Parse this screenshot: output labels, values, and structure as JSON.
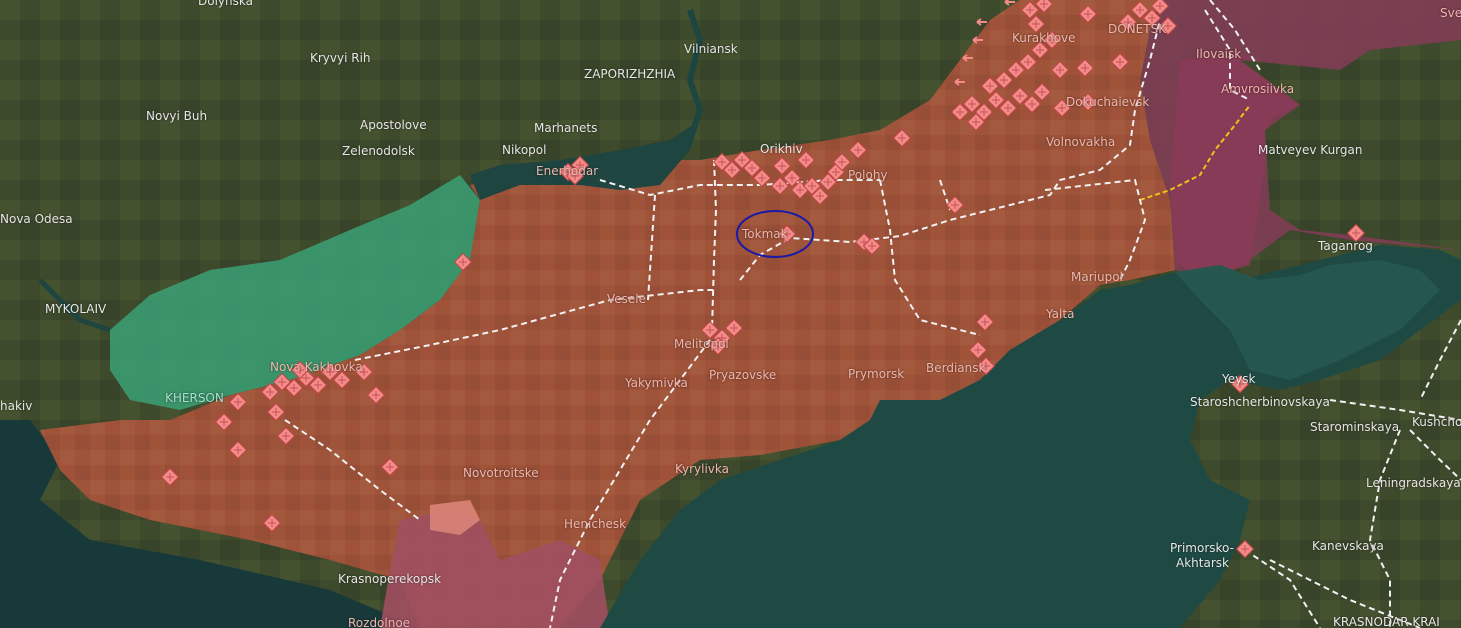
{
  "map": {
    "colors": {
      "occupied": "#a5533a",
      "liberated": "#3aa074",
      "russia": "#8a3b57",
      "sea": "#1f4a44",
      "marker": "#f38b8b",
      "frontline_yellow": "#f1c11b",
      "highlight_circle": "#1a1aa8"
    },
    "labels": {
      "dolynska": "Dolynska",
      "kryvyi_rih": "Kryvyi Rih",
      "novyi_buh": "Novyi Buh",
      "apostolove": "Apostolove",
      "zelenodolsk": "Zelenodolsk",
      "nova_odesa": "Nova Odesa",
      "mykolaiv": "MYKOLAIV",
      "kherson": "KHERSON",
      "khakiv": "hakiv",
      "vilniansk": "Vilniansk",
      "zaporizhzhia": "ZAPORIZHZHIA",
      "marhanets": "Marhanets",
      "nikopol": "Nikopol",
      "enerhodar": "Enerhodar",
      "orikhiv": "Orikhiv",
      "polohy": "Polohy",
      "tokmak": "Tokmak",
      "vesele": "Vesele",
      "melitopol": "Melitopol",
      "yakymivka": "Yakymivka",
      "pryazovske": "Pryazovske",
      "prymorsk": "Prymorsk",
      "berdiansk": "Berdiansk",
      "yalta": "Yalta",
      "mariupol": "Mariupol",
      "volnovakha": "Volnovakha",
      "dokuchaievsk": "Dokuchaievsk",
      "kurakhove": "Kurakhove",
      "donetsk": "DONETSK",
      "ilovaisk": "Ilovaisk",
      "amvrosiivka": "Amvrosiivka",
      "matveyev_kurgan": "Matveyev Kurgan",
      "taganrog": "Taganrog",
      "yeysk": "Yeysk",
      "staroshcherbinovskaya": "Staroshcherbinovskaya",
      "starominskaya": "Starominskaya",
      "kushchevskaya": "Kushcho",
      "leningradskaya": "Leningradskaya",
      "kanevskaya": "Kanevskaya",
      "primorsko_akhtarsk_1": "Primorsko-",
      "primorsko_akhtarsk_2": "Akhtarsk",
      "krasnodar_krai": "KRASNODAR KRAI",
      "novotroitske": "Novotroitske",
      "kyrylivka": "Kyrylivka",
      "henichesk": "Henichesk",
      "krasnoperekopsk": "Krasnoperekopsk",
      "rozdolne": "Rozdolnoe",
      "svetlograd": "Sve",
      "nova_kakhovka": "Nova Kakhovka"
    }
  }
}
